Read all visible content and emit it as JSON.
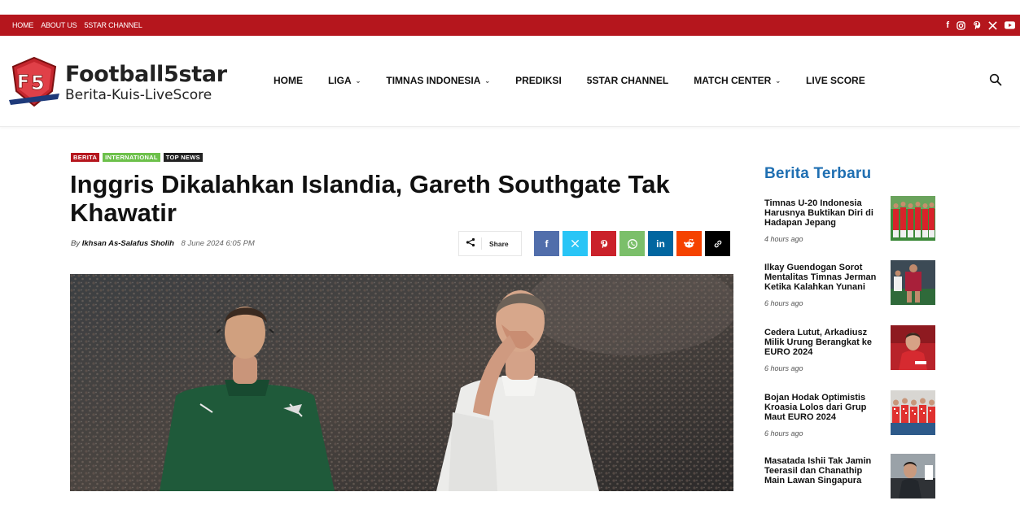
{
  "topbar": {
    "links": [
      "HOME",
      "ABOUT US",
      "5STAR CHANNEL"
    ],
    "social_icons": [
      "facebook-icon",
      "instagram-icon",
      "pinterest-icon",
      "x-icon",
      "youtube-icon"
    ]
  },
  "logo": {
    "title": "Football5star",
    "subtitle": "Berita-Kuis-LiveScore",
    "badge_text": "Football5star"
  },
  "nav": {
    "home": "HOME",
    "liga": "LIGA",
    "timnas": "TIMNAS INDONESIA",
    "prediksi": "PREDIKSI",
    "channel": "5STAR CHANNEL",
    "match_center": "MATCH CENTER",
    "live_score": "LIVE SCORE"
  },
  "article": {
    "categories": [
      {
        "label": "BERITA",
        "color": "#b5161d"
      },
      {
        "label": "INTERNATIONAL",
        "color": "#6cc04a"
      },
      {
        "label": "TOP NEWS",
        "color": "#222222"
      }
    ],
    "title": "Inggris Dikalahkan Islandia, Gareth Southgate Tak Khawatir",
    "by": "By",
    "author": "Ikhsan As-Salafus Sholih",
    "date": "8 June 2024 6:05 PM",
    "share_label": "Share",
    "share_buttons": [
      {
        "name": "facebook",
        "glyph": "f",
        "color": "#516eab"
      },
      {
        "name": "x",
        "glyph": "𝕏",
        "color": "#29c5f6"
      },
      {
        "name": "pinterest",
        "glyph": "P",
        "color": "#ca212a"
      },
      {
        "name": "whatsapp",
        "glyph": "✆",
        "color": "#7bbf6a"
      },
      {
        "name": "linkedin",
        "glyph": "in",
        "color": "#0266a0"
      },
      {
        "name": "reddit",
        "glyph": "◉",
        "color": "#f54200"
      },
      {
        "name": "copy-link",
        "glyph": "🔗",
        "color": "#000000"
      }
    ]
  },
  "sidebar": {
    "title": "Berita Terbaru",
    "items": [
      {
        "title": "Timnas U-20 Indonesia Harusnya Buktikan Diri di Hadapan Jepang",
        "time": "4 hours ago"
      },
      {
        "title": "Ilkay Guendogan Sorot Mentalitas Timnas Jerman Ketika Kalahkan Yunani",
        "time": "6 hours ago"
      },
      {
        "title": "Cedera Lutut, Arkadiusz Milik Urung Berangkat ke EURO 2024",
        "time": "6 hours ago"
      },
      {
        "title": "Bojan Hodak Optimistis Kroasia Lolos dari Grup Maut EURO 2024",
        "time": "6 hours ago"
      },
      {
        "title": "Masatada Ishii Tak Jamin Teerasil dan Chanathip Main Lawan Singapura",
        "time": ""
      }
    ]
  },
  "colors": {
    "brand_red": "#b5161d",
    "sidebar_title_blue": "#1f6fb2"
  }
}
